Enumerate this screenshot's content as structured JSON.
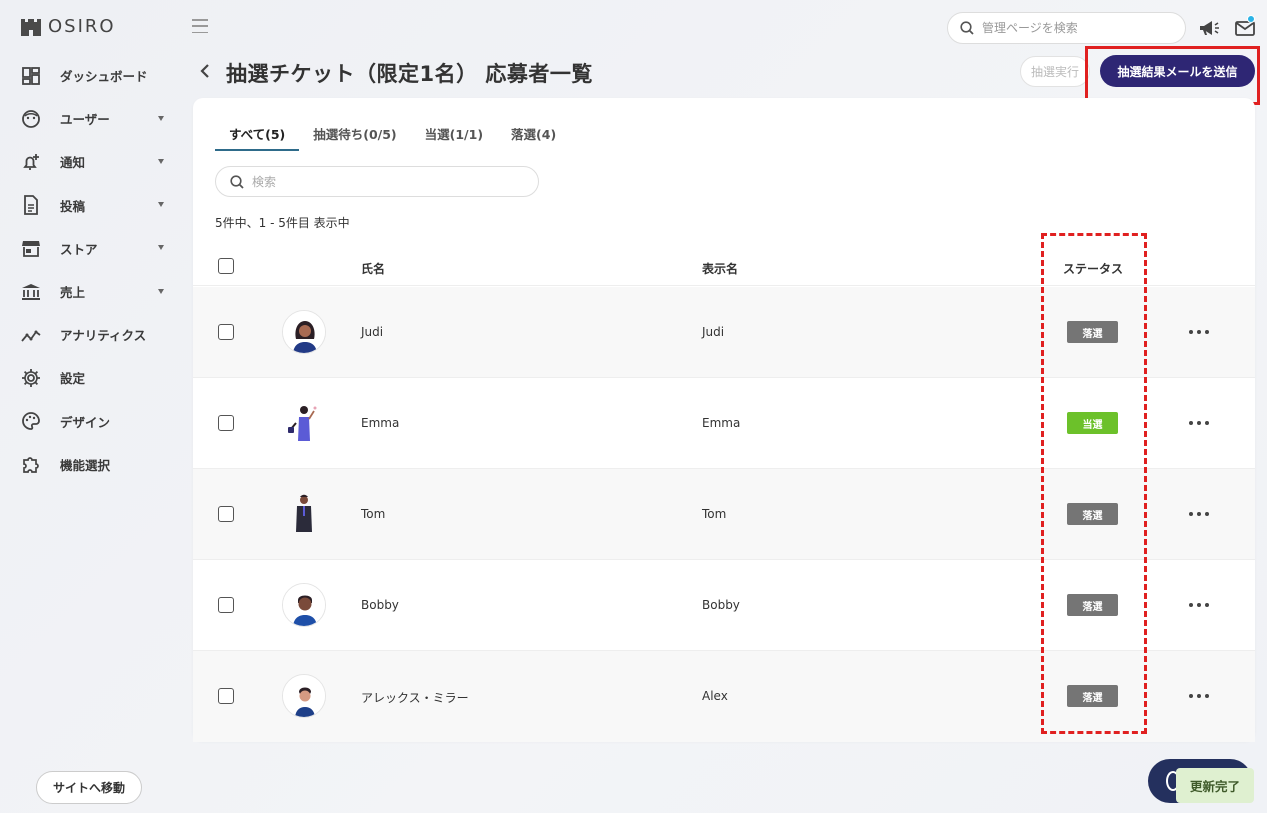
{
  "app": {
    "logo_text": "OSIRO"
  },
  "sidebar": {
    "items": [
      {
        "label": "ダッシュボード",
        "icon": "dashboard-icon",
        "caret": false
      },
      {
        "label": "ユーザー",
        "icon": "user-face-icon",
        "caret": true
      },
      {
        "label": "通知",
        "icon": "bell-plus-icon",
        "caret": true
      },
      {
        "label": "投稿",
        "icon": "document-icon",
        "caret": true
      },
      {
        "label": "ストア",
        "icon": "store-icon",
        "caret": true
      },
      {
        "label": "売上",
        "icon": "bank-icon",
        "caret": true
      },
      {
        "label": "アナリティクス",
        "icon": "analytics-icon",
        "caret": false
      },
      {
        "label": "設定",
        "icon": "gear-icon",
        "caret": false
      },
      {
        "label": "デザイン",
        "icon": "palette-icon",
        "caret": false
      },
      {
        "label": "機能選択",
        "icon": "puzzle-icon",
        "caret": false
      }
    ],
    "site_button": "サイトへ移動"
  },
  "topbar": {
    "search_placeholder": "管理ページを検索",
    "mail_has_notification": true
  },
  "page": {
    "title": "抽選チケット（限定1名） 応募者一覧",
    "run_button": "抽選実行",
    "send_button": "抽選結果メールを送信"
  },
  "list": {
    "tabs": [
      {
        "label": "すべて(5)",
        "active": true
      },
      {
        "label": "抽選待ち(0/5)",
        "active": false
      },
      {
        "label": "当選(1/1)",
        "active": false
      },
      {
        "label": "落選(4)",
        "active": false
      }
    ],
    "search_placeholder": "検索",
    "count_text": "5件中、1 - 5件目 表示中",
    "columns": {
      "name": "氏名",
      "display_name": "表示名",
      "status": "ステータス"
    },
    "rows": [
      {
        "name": "Judi",
        "display_name": "Judi",
        "status": "落選",
        "status_color": "#757575"
      },
      {
        "name": "Emma",
        "display_name": "Emma",
        "status": "当選",
        "status_color": "#6cc12a"
      },
      {
        "name": "Tom",
        "display_name": "Tom",
        "status": "落選",
        "status_color": "#757575"
      },
      {
        "name": "Bobby",
        "display_name": "Bobby",
        "status": "落選",
        "status_color": "#757575"
      },
      {
        "name": "アレックス・ミラー",
        "display_name": "Alex",
        "status": "落選",
        "status_color": "#757575"
      }
    ]
  },
  "toast": {
    "text": "更新完了"
  },
  "colors": {
    "primary": "#2e2674",
    "highlight": "#e02020",
    "win": "#6cc12a",
    "lose": "#757575"
  }
}
